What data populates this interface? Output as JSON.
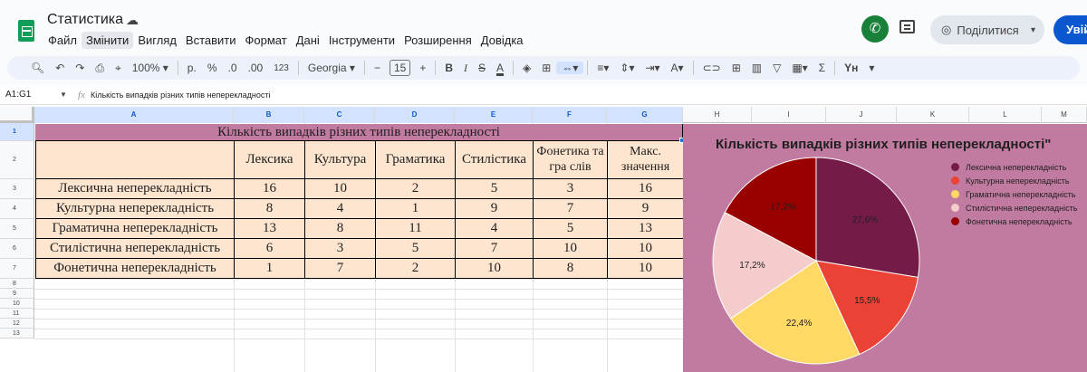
{
  "app": {
    "title": "Статистика",
    "menu": [
      "Файл",
      "Змінити",
      "Вигляд",
      "Вставити",
      "Формат",
      "Дані",
      "Інструменти",
      "Розширення",
      "Довідка"
    ],
    "active_menu_index": 1,
    "share_label": "Поділитися",
    "signin_label": "Увій"
  },
  "toolbar": {
    "zoom": "100%",
    "currency": "р.",
    "percent": "%",
    "dec_less": ".0",
    "dec_more": ".00",
    "number_format": "123",
    "font": "Georgia",
    "font_size": "15",
    "minus": "−",
    "plus": "+",
    "bold": "B",
    "italic": "I",
    "strike": "S",
    "text_color": "A",
    "sum": "Σ",
    "input_tools": "Yн"
  },
  "formula_bar": {
    "name_box": "A1:G1",
    "fx": "fx",
    "content": "Кількість випадків різних типів неперекладності"
  },
  "sheet": {
    "columns": [
      "A",
      "B",
      "C",
      "D",
      "E",
      "F",
      "G",
      "H",
      "I",
      "J",
      "K",
      "L",
      "M"
    ],
    "rows": [
      "1",
      "2",
      "3",
      "4",
      "5",
      "6",
      "7",
      "8",
      "9",
      "10",
      "11",
      "12",
      "13"
    ],
    "table_title": "Кількість випадків різних типів неперекладності",
    "headers": [
      "",
      "Лексика",
      "Культура",
      "Граматика",
      "Стилістика",
      "Фонетика та гра слів",
      "Макс. значення"
    ],
    "body": [
      [
        "Лексична неперекладність",
        "16",
        "10",
        "2",
        "5",
        "3",
        "16"
      ],
      [
        "Культурна неперекладність",
        "8",
        "4",
        "1",
        "9",
        "7",
        "9"
      ],
      [
        "Граматична неперекладність",
        "13",
        "8",
        "11",
        "4",
        "5",
        "13"
      ],
      [
        "Стилістична неперекладність",
        "6",
        "3",
        "5",
        "7",
        "10",
        "10"
      ],
      [
        "Фонетична неперекладність",
        "1",
        "7",
        "2",
        "10",
        "8",
        "10"
      ]
    ]
  },
  "chart_data": {
    "type": "pie",
    "title": "Кількість випадків різних типів неперекладності\"",
    "legend_position": "right",
    "background": "#c27ba0",
    "slices": [
      {
        "name": "Лексична неперекладність",
        "value": 16,
        "label": "27,6%",
        "color": "#741b47"
      },
      {
        "name": "Культурна неперекладність",
        "value": 9,
        "label": "15,5%",
        "color": "#ea4335"
      },
      {
        "name": "Граматична неперекладність",
        "value": 13,
        "label": "22,4%",
        "color": "#ffd966"
      },
      {
        "name": "Стилістична неперекладність",
        "value": 10,
        "label": "17,2%",
        "color": "#f4cccc"
      },
      {
        "name": "Фонетична неперекладність",
        "value": 10,
        "label": "17,2%",
        "color": "#990000"
      }
    ]
  }
}
